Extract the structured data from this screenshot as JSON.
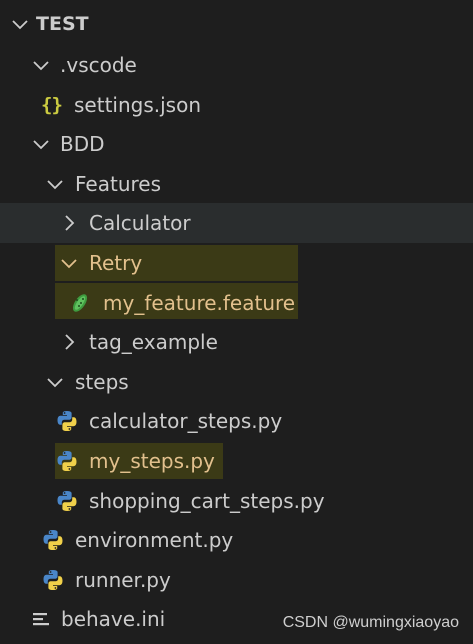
{
  "explorer": {
    "root": {
      "label": "TEST",
      "expanded": true
    },
    "items": [
      {
        "label": ".vscode",
        "kind": "folder",
        "expanded": true
      },
      {
        "label": "settings.json",
        "kind": "file",
        "icon": "json-braces-icon"
      },
      {
        "label": "BDD",
        "kind": "folder",
        "expanded": true
      },
      {
        "label": "Features",
        "kind": "folder",
        "expanded": true
      },
      {
        "label": "Calculator",
        "kind": "folder",
        "expanded": false,
        "state": "hovered"
      },
      {
        "label": "Retry",
        "kind": "folder",
        "expanded": true,
        "state": "highlighted"
      },
      {
        "label": "my_feature.feature",
        "kind": "file",
        "icon": "cucumber-icon",
        "state": "highlighted"
      },
      {
        "label": "tag_example",
        "kind": "folder",
        "expanded": false
      },
      {
        "label": "steps",
        "kind": "folder",
        "expanded": true
      },
      {
        "label": "calculator_steps.py",
        "kind": "file",
        "icon": "python-icon"
      },
      {
        "label": "my_steps.py",
        "kind": "file",
        "icon": "python-icon",
        "state": "highlighted"
      },
      {
        "label": "shopping_cart_steps.py",
        "kind": "file",
        "icon": "python-icon"
      },
      {
        "label": "environment.py",
        "kind": "file",
        "icon": "python-icon"
      },
      {
        "label": "runner.py",
        "kind": "file",
        "icon": "python-icon"
      },
      {
        "label": "behave.ini",
        "kind": "file",
        "icon": "settings-lines-icon"
      }
    ]
  },
  "json_icon_glyph": "{}",
  "watermark": "CSDN @wumingxiaoyao",
  "colors": {
    "background": "#1e1e1e",
    "text": "#cccccc",
    "highlight_text": "#e2c08d",
    "highlight_background": "#3b3a16",
    "hover_background": "#2a2d2e",
    "python_blue": "#4a86c8",
    "python_yellow": "#f0d04a",
    "json_yellow": "#cbcb41",
    "cucumber_green": "#4caf50"
  }
}
